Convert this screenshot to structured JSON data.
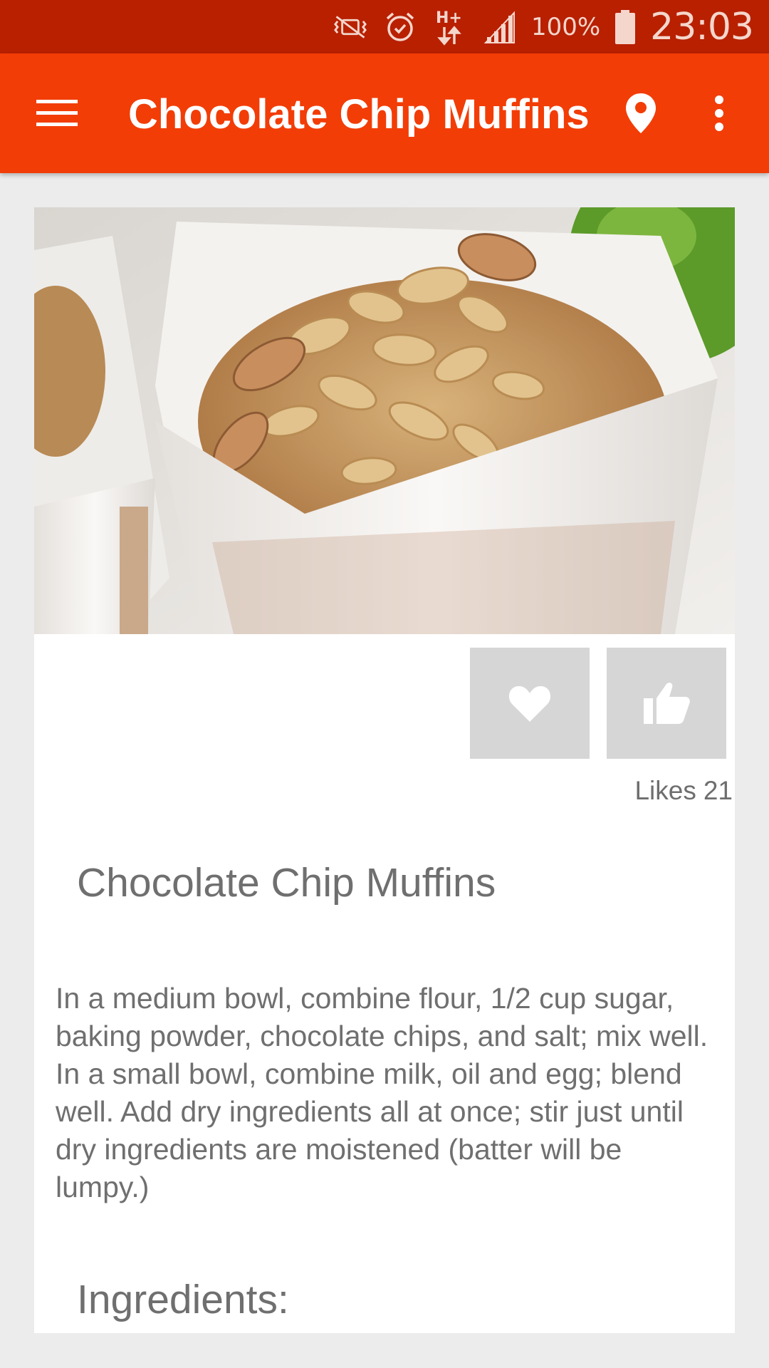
{
  "status_bar": {
    "icons": [
      "vibrate-off-icon",
      "alarm-icon",
      "hplus-data-icon",
      "signal-icon",
      "battery-icon"
    ],
    "network_label": "H+",
    "battery_percent": "100%",
    "time": "23:03"
  },
  "app_bar": {
    "title": "Chocolate Chip Muffins",
    "icons": [
      "menu-icon",
      "location-pin-icon",
      "more-vert-icon"
    ]
  },
  "recipe": {
    "likes_label": "Likes",
    "likes_count": "21",
    "title": "Chocolate Chip Muffins",
    "description": "In a medium bowl, combine flour, 1/2 cup sugar, baking powder, chocolate chips, and salt; mix well. In a small bowl, combine milk, oil and egg; blend well. Add dry ingredients all at once; stir just until dry ingredients are moistened (batter will be lumpy.)",
    "ingredients_heading": "Ingredients:"
  },
  "colors": {
    "status_bar": "#B82000",
    "app_bar": "#F23D07",
    "background": "#ECECEC",
    "card": "#FFFFFF",
    "action_button": "#D6D6D6",
    "text_secondary": "#6F6F6F"
  }
}
